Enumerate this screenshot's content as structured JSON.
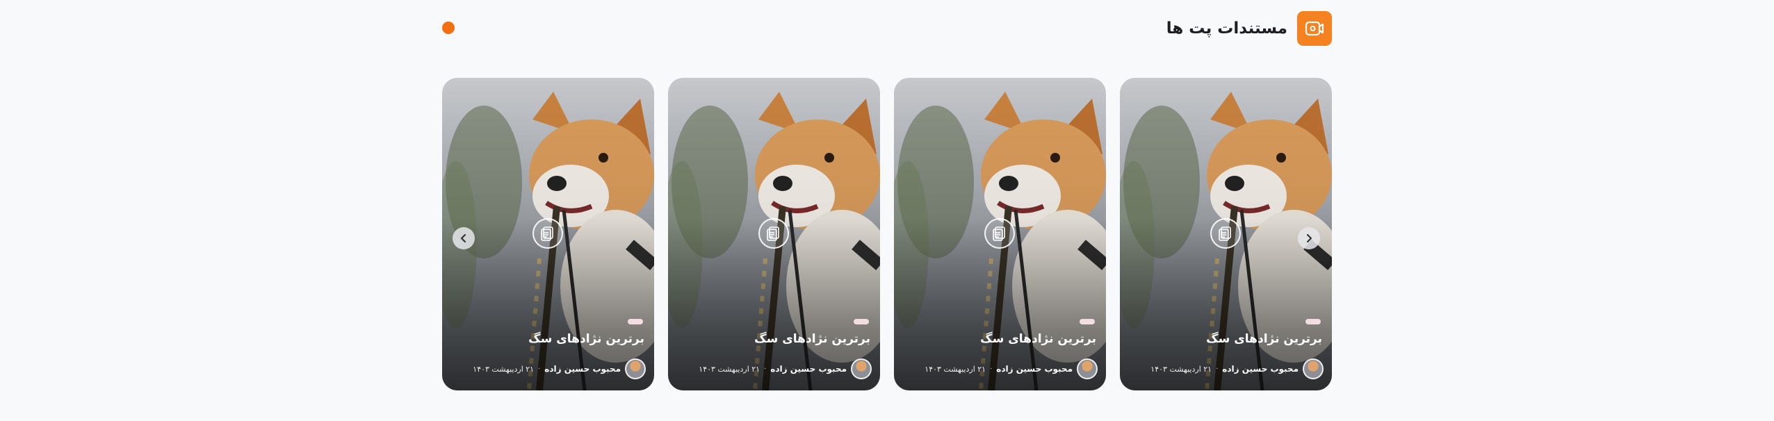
{
  "section": {
    "title": "مستندات پت ها",
    "icon": "video-document-icon",
    "accent_color": "#f58220"
  },
  "cards": [
    {
      "title": "برترین نژادهای سگ",
      "author": "محبوب حسین زاده",
      "separator": "·",
      "date": "۲۱ اردیبهشت ۱۴۰۳",
      "icon": "document-icon"
    },
    {
      "title": "برترین نژادهای سگ",
      "author": "محبوب حسین زاده",
      "separator": "·",
      "date": "۲۱ اردیبهشت ۱۴۰۳",
      "icon": "document-icon"
    },
    {
      "title": "برترین نژادهای سگ",
      "author": "محبوب حسین زاده",
      "separator": "·",
      "date": "۲۱ اردیبهشت ۱۴۰۳",
      "icon": "document-icon"
    },
    {
      "title": "برترین نژادهای سگ",
      "author": "محبوب حسین زاده",
      "separator": "·",
      "date": "۲۱ اردیبهشت ۱۴۰۳",
      "icon": "document-icon"
    }
  ],
  "navigation": {
    "prev_icon": "chevron-right-icon",
    "next_icon": "chevron-left-icon"
  }
}
